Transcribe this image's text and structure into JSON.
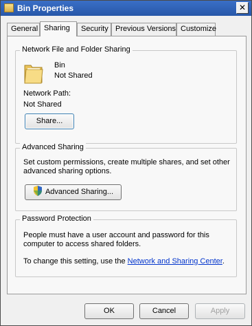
{
  "window": {
    "title": "Bin Properties",
    "close_label": "✕"
  },
  "tabs": [
    {
      "label": "General"
    },
    {
      "label": "Sharing"
    },
    {
      "label": "Security"
    },
    {
      "label": "Previous Versions"
    },
    {
      "label": "Customize"
    }
  ],
  "network_sharing": {
    "legend": "Network File and Folder Sharing",
    "folder_name": "Bin",
    "folder_status": "Not Shared",
    "path_label": "Network Path:",
    "path_value": "Not Shared",
    "share_button": "Share..."
  },
  "advanced_sharing": {
    "legend": "Advanced Sharing",
    "desc_line1": "Set custom permissions, create multiple shares, and set other",
    "desc_line2": "advanced sharing options.",
    "button": "Advanced Sharing..."
  },
  "password_protection": {
    "legend": "Password Protection",
    "desc_line1": "People must have a user account and password for this",
    "desc_line2": "computer to access shared folders.",
    "change_prefix": "To change this setting, use the ",
    "link_text": "Network and Sharing Center",
    "change_suffix": "."
  },
  "footer": {
    "ok": "OK",
    "cancel": "Cancel",
    "apply": "Apply"
  }
}
